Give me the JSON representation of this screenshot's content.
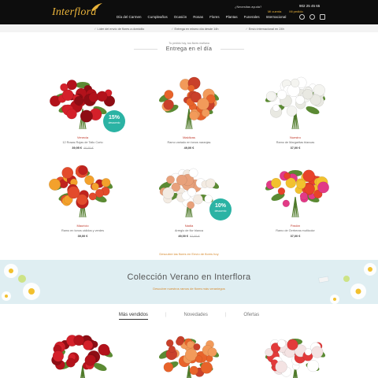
{
  "header": {
    "logo": "Interflora",
    "topline": "¿Necesitas ayuda?",
    "phone": "902 25 45 65",
    "account_links": [
      "Mi cuenta",
      "Mi pedido"
    ],
    "nav": [
      "Día del Carmen",
      "Cumpleaños",
      "Ocasión",
      "Rosas",
      "Flores",
      "Plantas",
      "Funerales",
      "Internacional"
    ]
  },
  "benefits": [
    "Líder del envío de flores a domicilio",
    "Entrega en mismo día desde 14h",
    "Envío internacional en 24h"
  ],
  "section": {
    "eyebrow": "Tu pedido hoy, tus flores mañana",
    "title": "Entrega en el día"
  },
  "products": [
    {
      "category": "Venecia",
      "name": "12 Rosas Rojas de Tallo Corto",
      "price": "39,95 €",
      "old_price": "46,95 €",
      "badge": {
        "pct": "15%",
        "text": "descuento"
      },
      "colors": [
        "#b3121b",
        "#d4202a",
        "#8e0d14"
      ]
    },
    {
      "category": "Maldivas",
      "name": "Ramo variado en tonos naranjas",
      "price": "49,00 €",
      "old_price": "",
      "badge": null,
      "colors": [
        "#e8632a",
        "#f29a5a",
        "#c9402a"
      ]
    },
    {
      "category": "Nuestro",
      "name": "Ramo de Margaritas blancas",
      "price": "37,00 €",
      "old_price": "",
      "badge": null,
      "colors": [
        "#ffffff",
        "#f4f4f0",
        "#e9e9e2"
      ]
    },
    {
      "category": "Mauricio",
      "name": "Ramo en tonos cálidos y verdes",
      "price": "39,00 €",
      "old_price": "",
      "badge": null,
      "colors": [
        "#e34b2c",
        "#f3a12c",
        "#c0221e"
      ]
    },
    {
      "category": "Nadia",
      "name": "Arreglo de flor blanca",
      "price": "49,00 €",
      "old_price": "57,95 €",
      "badge": {
        "pct": "10%",
        "text": "descuento"
      },
      "colors": [
        "#ffffff",
        "#f3ebe2",
        "#e8a17b"
      ]
    },
    {
      "category": "Pasión",
      "name": "Ramo de Gerberas multicolor",
      "price": "37,00 €",
      "old_price": "",
      "badge": null,
      "colors": [
        "#e23a86",
        "#f2c12e",
        "#e8422a"
      ]
    }
  ],
  "see_all": "Descubre las flores en Envío de flores hoy",
  "banner": {
    "title": "Colección Verano en Interflora",
    "subtitle": "Descubre nuestros ramos de flores más veraniegos"
  },
  "tabs": [
    "Más vendidos",
    "Novedades",
    "Ofertas"
  ],
  "bottom_products": [
    {
      "colors": [
        "#b3121b",
        "#d4202a",
        "#8e0d14"
      ]
    },
    {
      "colors": [
        "#e8632a",
        "#f29a5a",
        "#c9402a"
      ]
    },
    {
      "colors": [
        "#ffffff",
        "#e23a3a",
        "#f4e3e3"
      ]
    }
  ]
}
